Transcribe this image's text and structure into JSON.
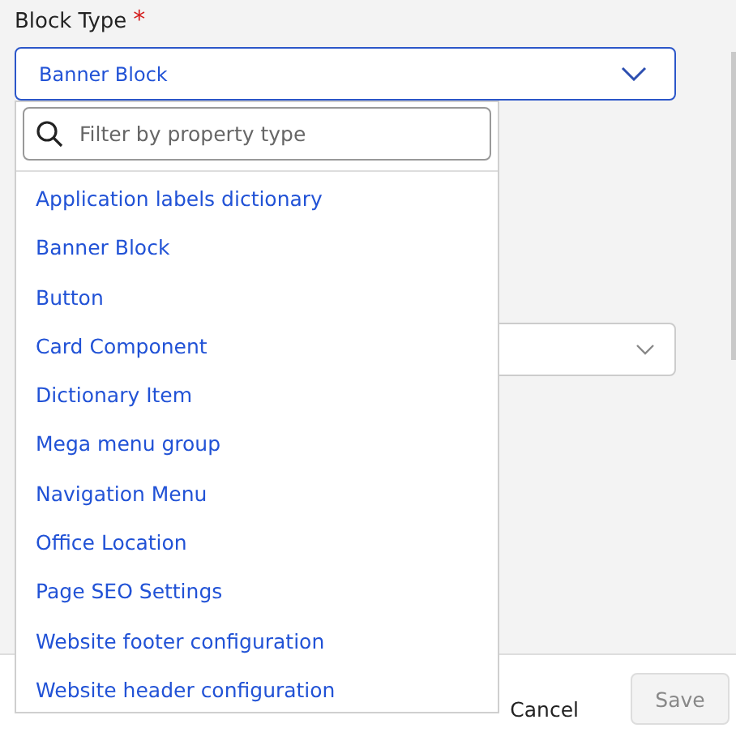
{
  "field": {
    "label": "Block Type",
    "required_mark": "*",
    "value": "Banner Block",
    "expanded": true
  },
  "dropdown": {
    "search": {
      "placeholder": "Filter by property type"
    },
    "options": [
      "Application labels dictionary",
      "Banner Block",
      "Button",
      "Card Component",
      "Dictionary Item",
      "Mega menu group",
      "Navigation Menu",
      "Office Location",
      "Page SEO Settings",
      "Website footer configuration",
      "Website header configuration"
    ]
  },
  "footer": {
    "cancel": "Cancel",
    "save": {
      "label": "Save",
      "disabled": true
    }
  }
}
